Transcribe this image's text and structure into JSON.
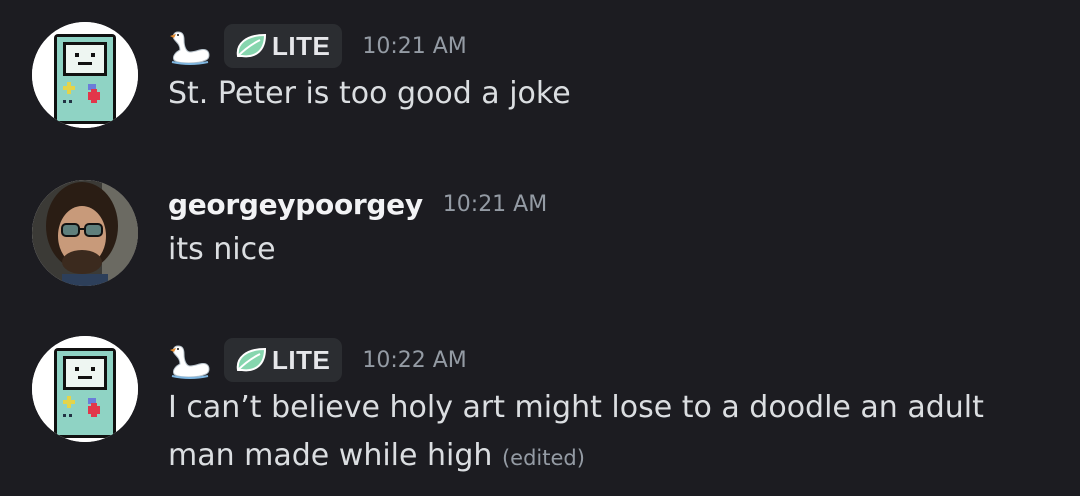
{
  "messages": [
    {
      "author": "",
      "badge": "LITE",
      "time": "10:21 AM",
      "text": "St. Peter is too good a joke",
      "edited": ""
    },
    {
      "author": "georgeypoorgey",
      "badge": "",
      "time": "10:21 AM",
      "text": "its nice",
      "edited": ""
    },
    {
      "author": "",
      "badge": "LITE",
      "time": "10:22 AM",
      "text": "I can’t believe holy art might lose to a doodle an adult man made while high",
      "edited": "(edited)"
    }
  ],
  "icons": {
    "avatar_1": "handheld-console-avatar",
    "avatar_2": "bearded-man-photo-avatar",
    "role_icon": "swan-icon",
    "badge_icon": "leaf-icon"
  },
  "colors": {
    "background": "#1c1c21",
    "text": "#dbdee1",
    "timestamp": "#949ba4",
    "badge_bg": "#2b2d31",
    "leaf": "#86d6ae"
  }
}
